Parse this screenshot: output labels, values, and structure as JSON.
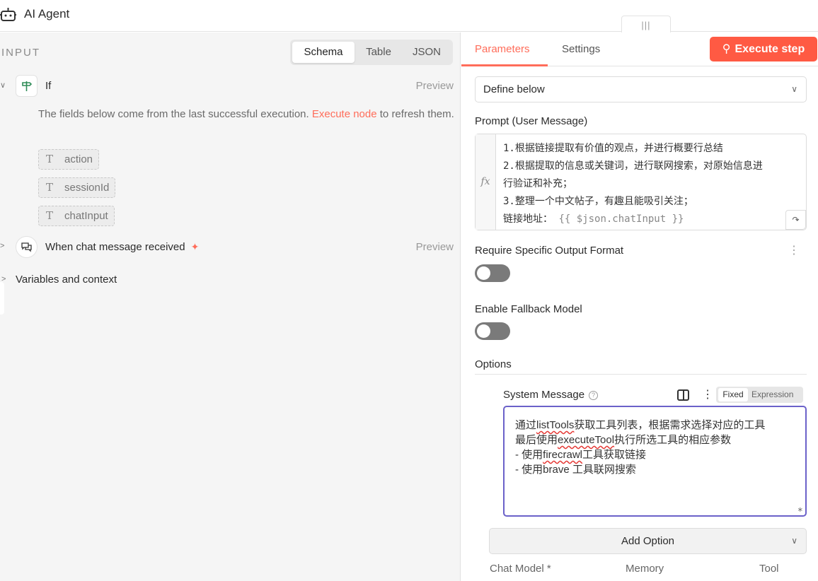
{
  "header": {
    "title": "AI Agent",
    "drag_handle": "|||"
  },
  "input_panel": {
    "label": "INPUT",
    "view_tabs": [
      "Schema",
      "Table",
      "JSON"
    ],
    "nodes": [
      {
        "name": "If",
        "preview": "Preview"
      },
      {
        "name": "When chat message received",
        "preview": "Preview"
      }
    ],
    "hint_before": "The fields below come from the last successful execution. ",
    "hint_link": "Execute node",
    "hint_after": " to refresh them.",
    "fields": [
      {
        "type_icon": "T",
        "name": "action"
      },
      {
        "type_icon": "T",
        "name": "sessionId"
      },
      {
        "type_icon": "T",
        "name": "chatInput"
      }
    ],
    "variables": "Variables and context"
  },
  "params_panel": {
    "tabs": [
      "Parameters",
      "Settings"
    ],
    "execute_label": "Execute step",
    "source_select": "Define below",
    "prompt_label": "Prompt (User Message)",
    "prompt_lines": [
      "1.根据链接提取有价值的观点，并进行概要行总结",
      "2.根据提取的信息或关键词，进行联网搜索，对原始信息进",
      "行验证和补充；",
      "3.整理一个中文帖子，有趣且能吸引关注；"
    ],
    "prompt_last_prefix": "链接地址： ",
    "prompt_expression": "{{ $json.chatInput }}",
    "fx": "fx",
    "require_format_label": "Require Specific Output Format",
    "require_format_on": false,
    "fallback_label": "Enable Fallback Model",
    "fallback_on": false,
    "options_label": "Options",
    "system_message_label": "System Message",
    "mode_fixed": "Fixed",
    "mode_expression": "Expression",
    "system_message_lines": {
      "l1a": "通过",
      "l1b": "listTools",
      "l1c": "获取工具列表，根据需求选择对应的工具",
      "l2a": "最后使用",
      "l2b": "executeTool",
      "l2c": "执行所选工具的相应参数",
      "l3a": "- 使用",
      "l3b": "firecrawl",
      "l3c": "工具获取链接",
      "l4": "- 使用brave 工具联网搜索"
    },
    "add_option": "Add Option",
    "sub_nodes": [
      "Chat Model *",
      "Memory",
      "Tool"
    ]
  },
  "colors": {
    "accent": "#ff6d5a",
    "execute_button": "#ff5a43",
    "focus_border": "#6b61c9"
  }
}
